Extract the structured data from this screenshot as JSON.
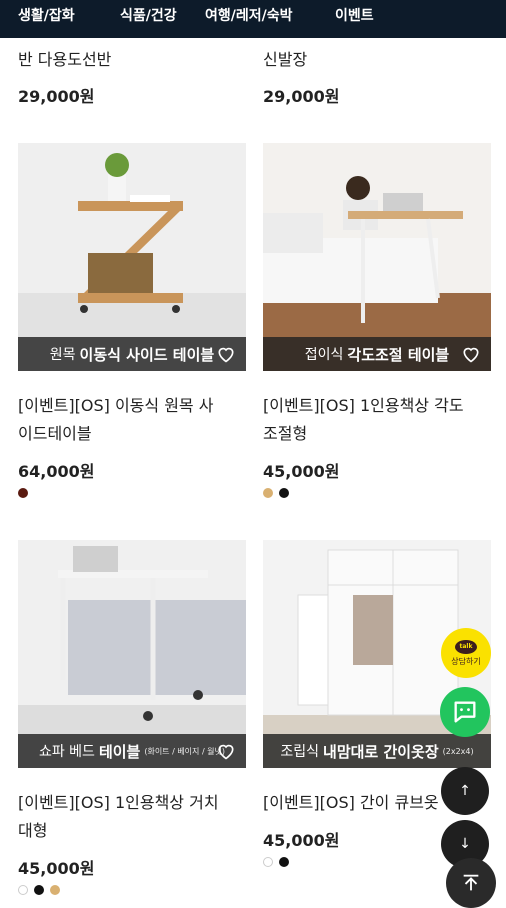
{
  "nav": {
    "items": [
      "생활/잡화",
      "식품/건강",
      "여행/레저/숙박",
      "이벤트"
    ]
  },
  "previous_row": {
    "left": {
      "name": "반 다용도선반",
      "price": "29,000원"
    },
    "right": {
      "name": "신발장",
      "price": "29,000원"
    }
  },
  "products": [
    {
      "overlay_prefix": "원목",
      "overlay_bold": "이동식 사이드 테이블",
      "overlay_note": "",
      "name_line1": "[이벤트][OS] 이동식 원목 사",
      "name_line2": "이드테이블",
      "price": "64,000원",
      "swatches": [
        "#5a1a10"
      ]
    },
    {
      "overlay_prefix": "접이식",
      "overlay_bold": "각도조절 테이블",
      "overlay_note": "",
      "name_line1": "[이벤트][OS] 1인용책상 각도",
      "name_line2": "조절형",
      "price": "45,000원",
      "swatches": [
        "#d9b071",
        "#111111"
      ]
    },
    {
      "overlay_prefix": "쇼파 베드",
      "overlay_bold": "테이블",
      "overlay_note": "(화이트 / 베이지 / 월넛)",
      "name_line1": "[이벤트][OS] 1인용책상 거치",
      "name_line2": "대형",
      "price": "45,000원",
      "swatches": [
        "#ffffff",
        "#111111",
        "#d9b071"
      ]
    },
    {
      "overlay_prefix": "조립식",
      "overlay_bold": "내맘대로 간이옷장",
      "overlay_note": "(2x2x4)",
      "name_line1": "[이벤트][OS] 간이 큐브옷",
      "name_line2": "",
      "price": "45,000원",
      "swatches": [
        "#ffffff",
        "#111111"
      ]
    }
  ],
  "floating": {
    "kakao_label": "상담하기",
    "kakao_bubble": "talk",
    "up_arrow": "↑",
    "down_arrow": "↓"
  },
  "colors": {
    "nav_bg": "#0d1b2a",
    "overlay_bg": "#222222",
    "kakao": "#fae100",
    "chat": "#22c55e"
  }
}
